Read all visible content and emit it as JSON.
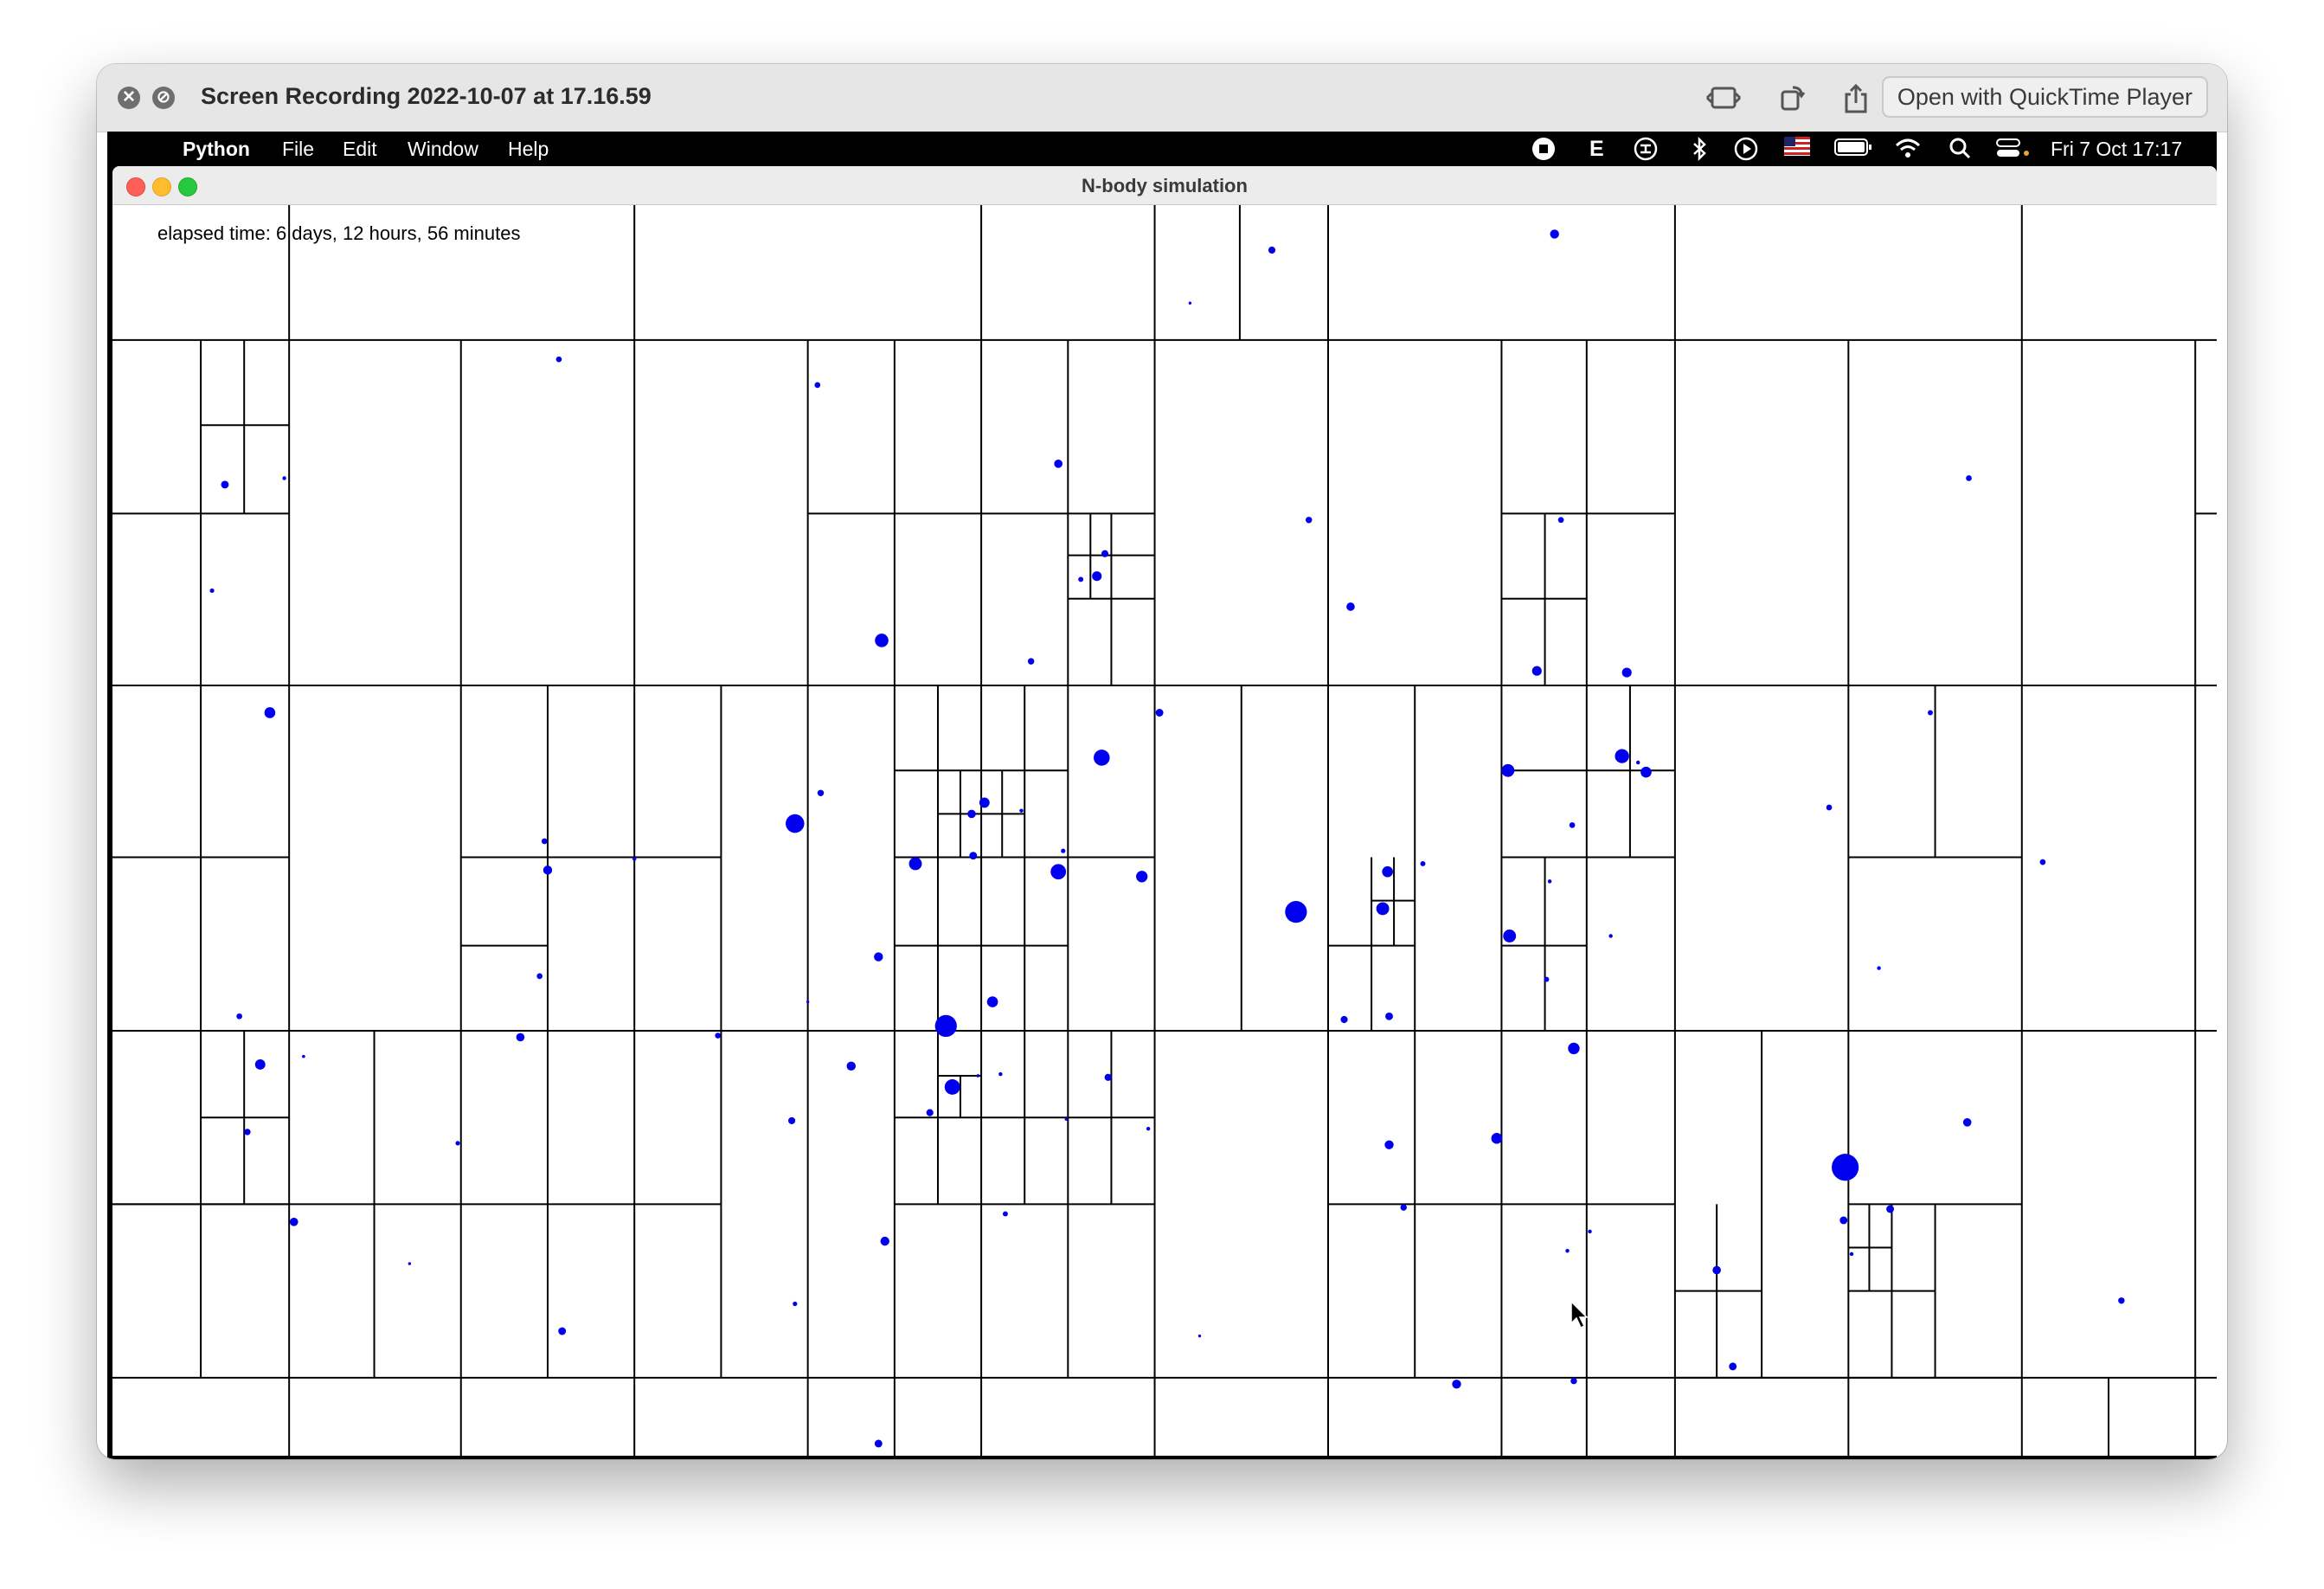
{
  "quicktime": {
    "title": "Screen Recording 2022-10-07 at 17.16.59",
    "open_button": "Open with QuickTime Player"
  },
  "menubar": {
    "app_name": "Python",
    "items": [
      "File",
      "Edit",
      "Window",
      "Help"
    ],
    "status_letter": "E",
    "datetime": "Fri 7 Oct  17:17"
  },
  "window": {
    "title": "N-body simulation"
  },
  "simulation": {
    "elapsed_label": "elapsed time: 6 days, 12 hours, 56 minutes",
    "body_color": "#0000ee",
    "line_color": "#000000"
  }
}
